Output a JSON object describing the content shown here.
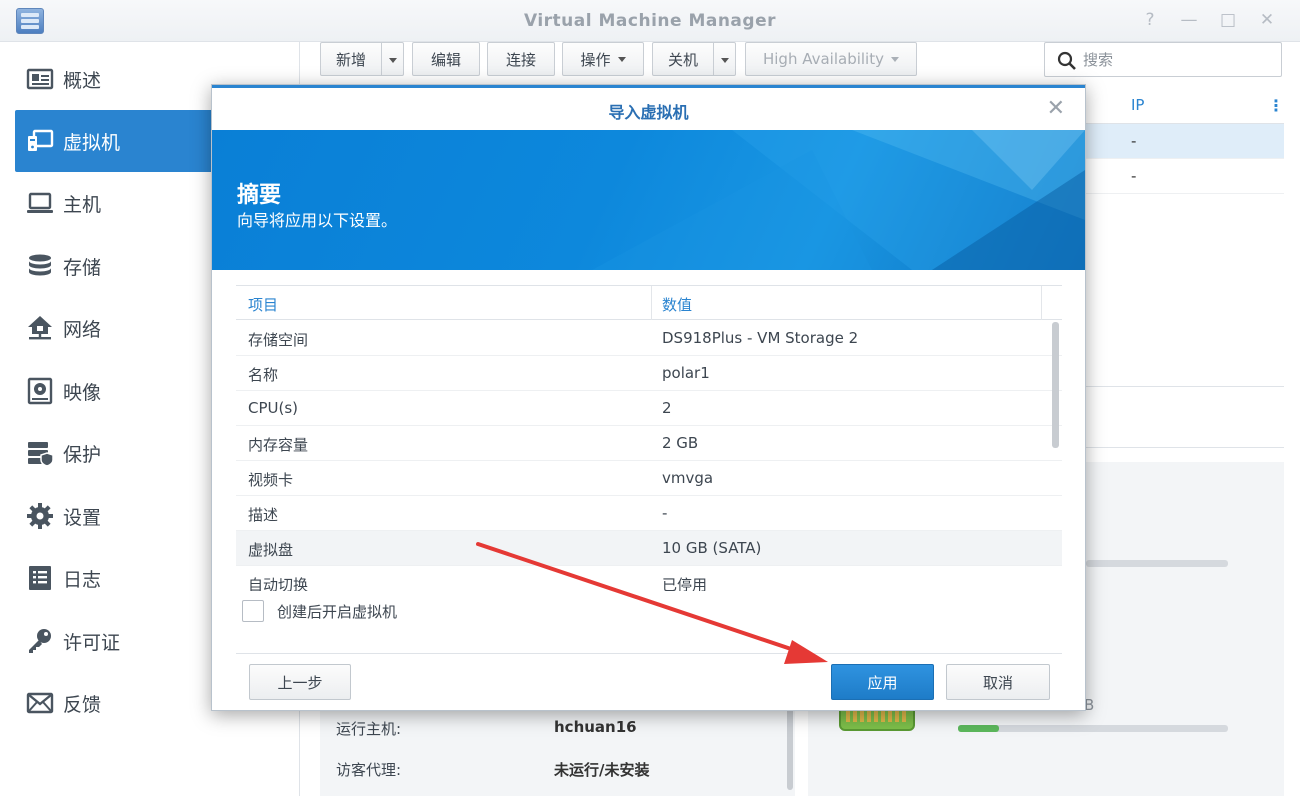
{
  "window": {
    "title": "Virtual Machine Manager",
    "controls": [
      "?",
      "—",
      "□",
      "✕"
    ]
  },
  "sidebar": {
    "items": [
      {
        "label": "概述",
        "icon": "overview-icon"
      },
      {
        "label": "虚拟机",
        "icon": "virtual-machine-icon",
        "active": true
      },
      {
        "label": "主机",
        "icon": "host-icon"
      },
      {
        "label": "存储",
        "icon": "storage-icon"
      },
      {
        "label": "网络",
        "icon": "network-icon"
      },
      {
        "label": "映像",
        "icon": "image-icon"
      },
      {
        "label": "保护",
        "icon": "protection-icon"
      },
      {
        "label": "设置",
        "icon": "settings-icon"
      },
      {
        "label": "日志",
        "icon": "log-icon"
      },
      {
        "label": "许可证",
        "icon": "license-icon"
      },
      {
        "label": "反馈",
        "icon": "feedback-icon"
      }
    ]
  },
  "toolbar": {
    "add": "新增",
    "edit": "编辑",
    "connect": "连接",
    "action": "操作",
    "shutdown": "关机",
    "high_availability": "High Availability",
    "search_placeholder": "搜索"
  },
  "grid": {
    "ip_header": "IP",
    "rows": [
      "-",
      "-"
    ]
  },
  "details": {
    "host_label": "运行主机:",
    "host_value": "hchuan16",
    "agent_label": "访客代理:",
    "agent_value": "未运行/未安装",
    "size_suffix": "B",
    "usage_fraction": 0.15
  },
  "dialog": {
    "title": "导入虚拟机",
    "heading": "摘要",
    "subheading": "向导将应用以下设置。",
    "columns": [
      "项目",
      "数值"
    ],
    "rows": [
      {
        "item": "存储空间",
        "value": "DS918Plus - VM Storage 2"
      },
      {
        "item": "名称",
        "value": "polar1"
      },
      {
        "item": "CPU(s)",
        "value": "2"
      },
      {
        "item": "内存容量",
        "value": "2 GB"
      },
      {
        "item": "视频卡",
        "value": "vmvga"
      },
      {
        "item": "描述",
        "value": "-"
      },
      {
        "item": "虚拟盘",
        "value": "10 GB (SATA)"
      },
      {
        "item": "自动切换",
        "value": "已停用"
      }
    ],
    "checkbox_label": "创建后开启虚拟机",
    "checkbox_checked": false,
    "back_button": "上一步",
    "apply_button": "应用",
    "cancel_button": "取消"
  },
  "colors": {
    "accent": "#2a84d0",
    "annotation_arrow": "#e53935"
  }
}
